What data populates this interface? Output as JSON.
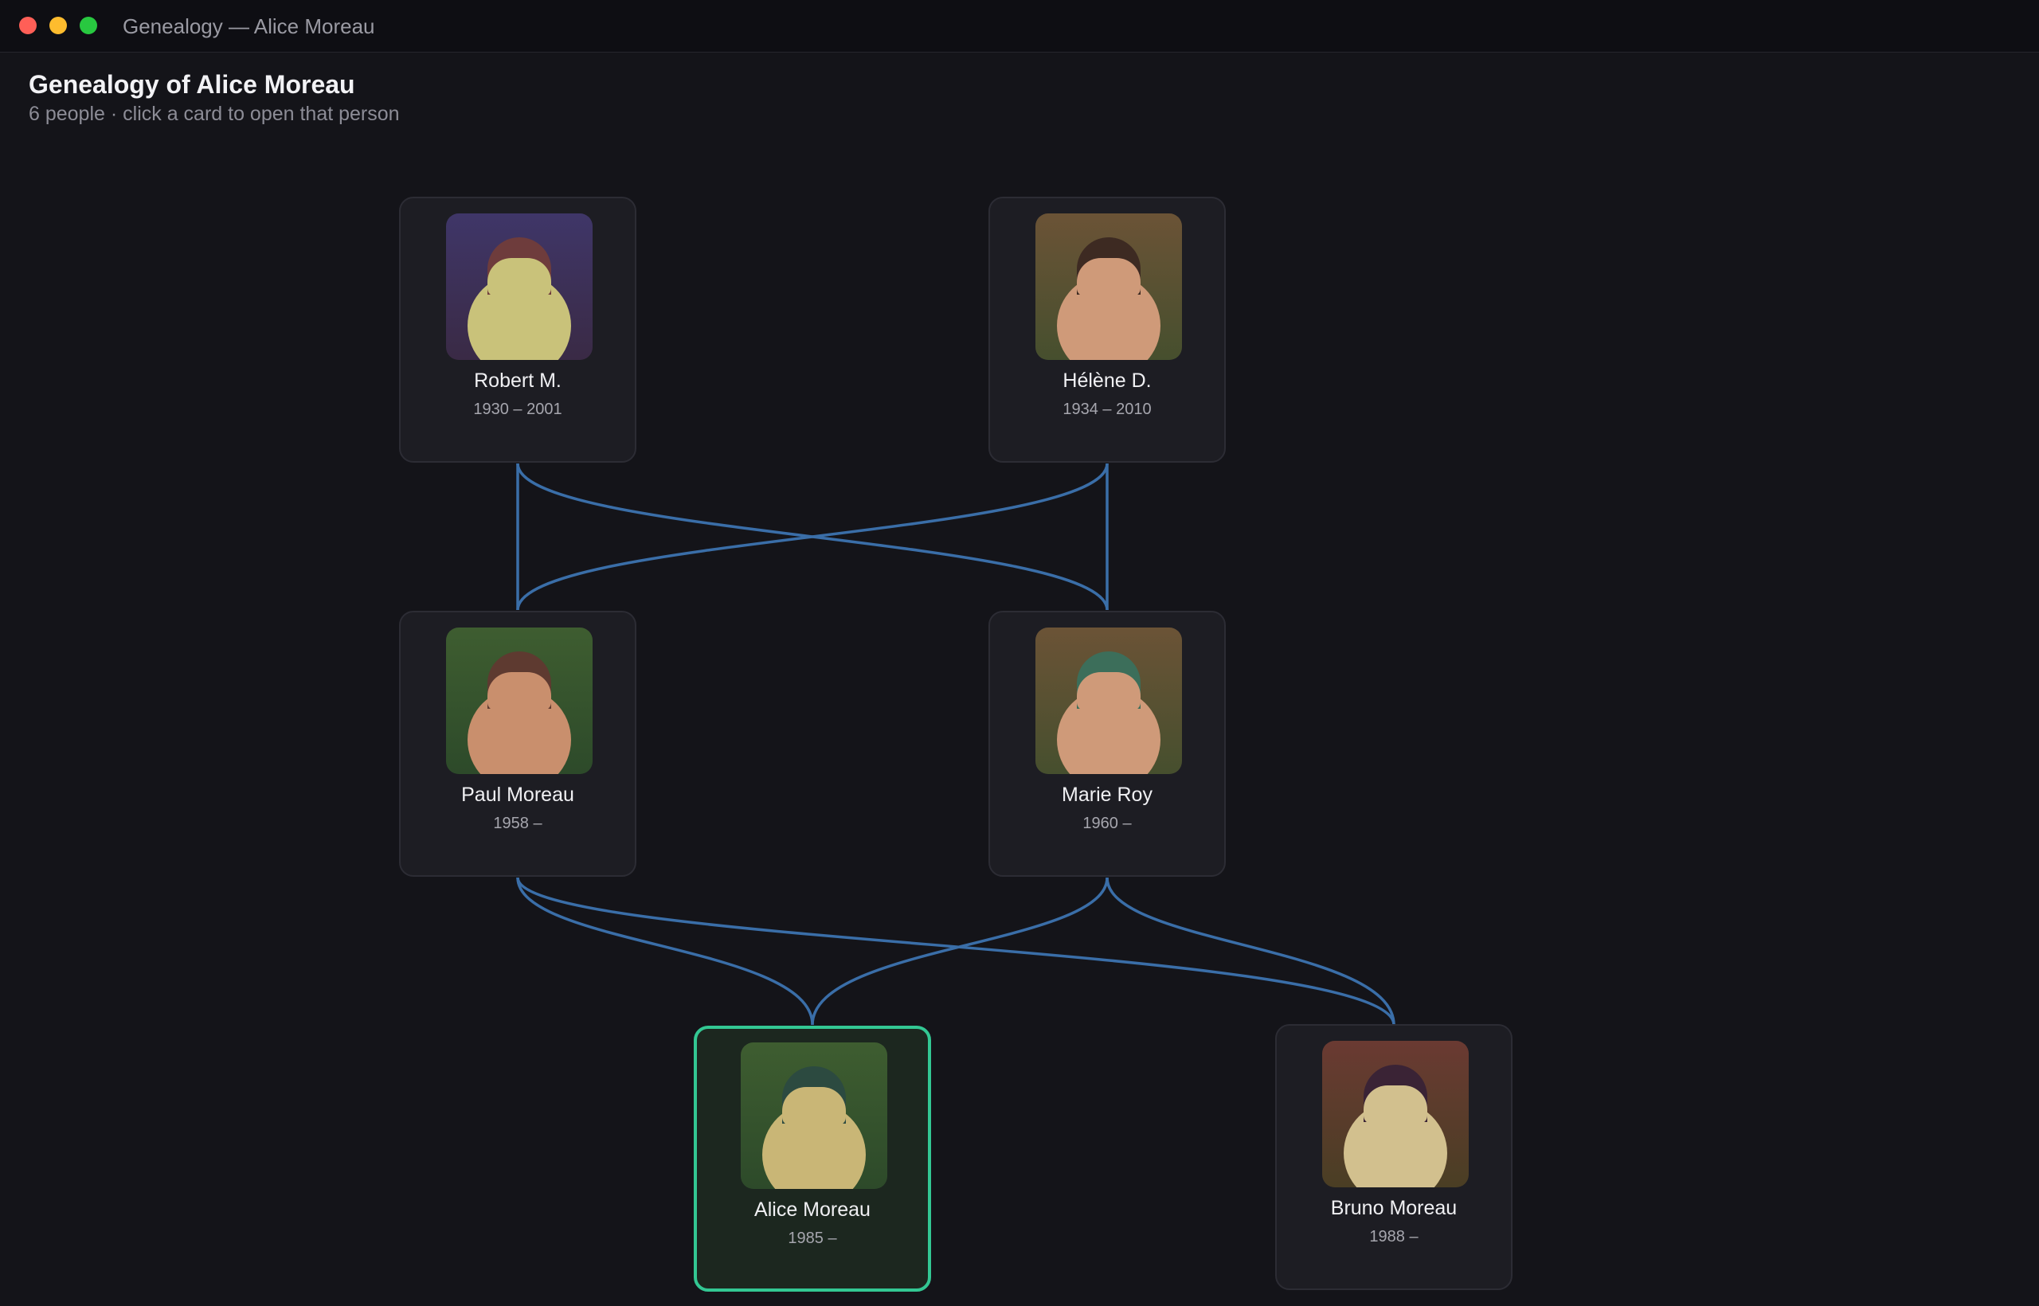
{
  "window": {
    "title": "Genealogy — Alice Moreau"
  },
  "header": {
    "title": "Genealogy of Alice Moreau",
    "subtitle": "6 people · click a card to open that person"
  },
  "people": [
    {
      "name": "Robert M.",
      "dates": "1930 – 2001",
      "portrait": {
        "bg_top": "#3f3668",
        "bg_bottom": "#3a2a45",
        "hair": "#6e3c3c",
        "skin": "#c9c27a"
      }
    },
    {
      "name": "Hélène D.",
      "dates": "1934 – 2010",
      "portrait": {
        "bg_top": "#6b5336",
        "bg_bottom": "#464f2e",
        "hair": "#3d2a22",
        "skin": "#cf9a79"
      }
    },
    {
      "name": "Paul Moreau",
      "dates": "1958 –",
      "portrait": {
        "bg_top": "#3e5d30",
        "bg_bottom": "#2d4a2a",
        "hair": "#5e3a30",
        "skin": "#c98f6d"
      }
    },
    {
      "name": "Marie Roy",
      "dates": "1960 –",
      "portrait": {
        "bg_top": "#6b5336",
        "bg_bottom": "#464f2e",
        "hair": "#3c6e5a",
        "skin": "#cf9a79"
      }
    },
    {
      "name": "Alice Moreau",
      "dates": "1985 –",
      "selected": true,
      "portrait": {
        "bg_top": "#3e5d30",
        "bg_bottom": "#2d4a2a",
        "hair": "#2c4a40",
        "skin": "#c9b676"
      }
    },
    {
      "name": "Bruno Moreau",
      "dates": "1988 –",
      "portrait": {
        "bg_top": "#6a3a32",
        "bg_bottom": "#4a3e24",
        "hair": "#3a2335",
        "skin": "#d2c08e"
      }
    }
  ]
}
